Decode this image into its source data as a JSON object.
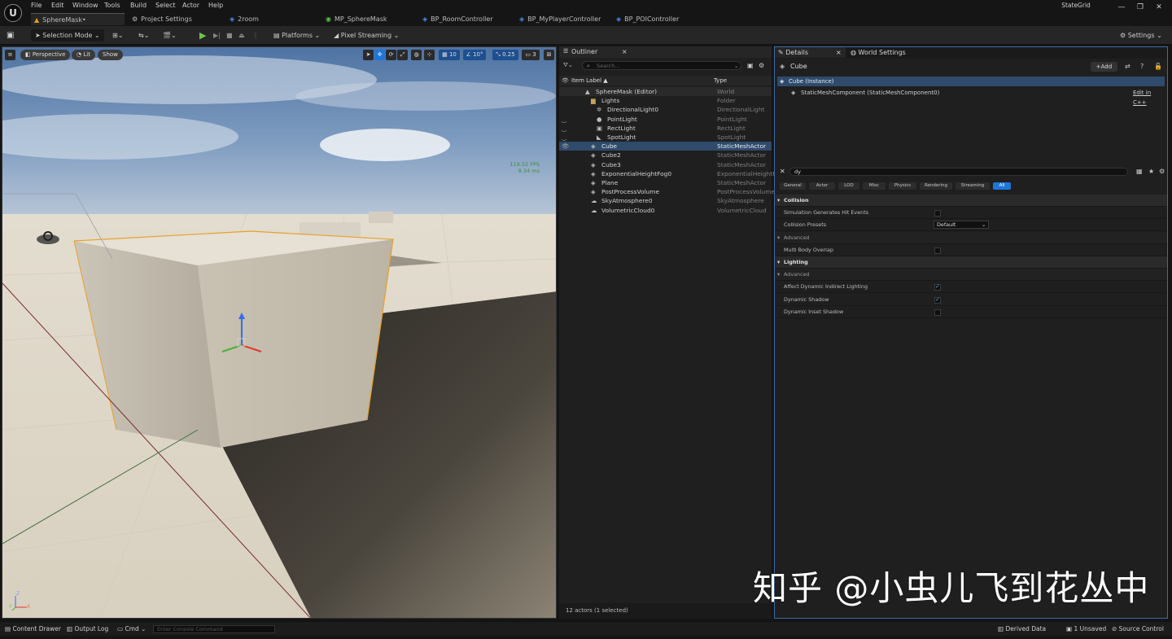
{
  "menu": [
    "File",
    "Edit",
    "Window",
    "Tools",
    "Build",
    "Select",
    "Actor",
    "Help"
  ],
  "tabs": [
    {
      "icon": "level-icon",
      "label": "SphereMask•",
      "active": true
    },
    {
      "icon": "settings-icon",
      "label": "Project Settings",
      "active": false
    },
    {
      "icon": "blueprint-icon",
      "label": "2room",
      "active": false
    },
    {
      "icon": "material-icon",
      "label": "MP_SphereMask",
      "active": false
    },
    {
      "icon": "blueprint-icon",
      "label": "BP_RoomController",
      "active": false
    },
    {
      "icon": "blueprint-icon",
      "label": "BP_MyPlayerController",
      "active": false
    },
    {
      "icon": "blueprint-icon",
      "label": "BP_POIController",
      "active": false
    }
  ],
  "project_name": "StateGrid",
  "toolbar": {
    "selection_mode": "Selection Mode",
    "platforms": "Platforms",
    "pixel_streaming": "Pixel Streaming",
    "settings": "Settings"
  },
  "viewport": {
    "perspective": "Perspective",
    "lit": "Lit",
    "show": "Show",
    "grid_snap": "10",
    "rot_snap": "10°",
    "scale_snap": "0.25",
    "camera_speed": "3",
    "fps": "119.52 FPS",
    "ms": "8.34 ms",
    "axis_z": "Z",
    "axis_y": "Y",
    "axis_x": "X"
  },
  "outliner": {
    "title": "Outliner",
    "search_placeholder": "Search...",
    "col_label": "Item Label",
    "col_type": "Type",
    "rows": [
      {
        "label": "SphereMask (Editor)",
        "type": "World",
        "indent": 2,
        "icon": "▲",
        "eye": false,
        "sel": false,
        "hl": true
      },
      {
        "label": "Lights",
        "type": "Folder",
        "indent": 3,
        "icon": "▆",
        "eye": false,
        "sel": false,
        "hl": false
      },
      {
        "label": "DirectionalLight0",
        "type": "DirectionalLight",
        "indent": 4,
        "icon": "✲",
        "eye": false,
        "sel": false,
        "hl": false
      },
      {
        "label": "PointLight",
        "type": "PointLight",
        "indent": 4,
        "icon": "●",
        "eye": true,
        "sel": false,
        "hl": false
      },
      {
        "label": "RectLight",
        "type": "RectLight",
        "indent": 4,
        "icon": "▣",
        "eye": true,
        "sel": false,
        "hl": false
      },
      {
        "label": "SpotLight",
        "type": "SpotLight",
        "indent": 4,
        "icon": "◣",
        "eye": true,
        "sel": false,
        "hl": false
      },
      {
        "label": "Cube",
        "type": "StaticMeshActor",
        "indent": 3,
        "icon": "◈",
        "eye": true,
        "sel": true,
        "hl": false
      },
      {
        "label": "Cube2",
        "type": "StaticMeshActor",
        "indent": 3,
        "icon": "◈",
        "eye": false,
        "sel": false,
        "hl": false
      },
      {
        "label": "Cube3",
        "type": "StaticMeshActor",
        "indent": 3,
        "icon": "◈",
        "eye": false,
        "sel": false,
        "hl": false
      },
      {
        "label": "ExponentialHeightFog0",
        "type": "ExponentialHeightFi",
        "indent": 3,
        "icon": "◈",
        "eye": false,
        "sel": false,
        "hl": false
      },
      {
        "label": "Plane",
        "type": "StaticMeshActor",
        "indent": 3,
        "icon": "◈",
        "eye": false,
        "sel": false,
        "hl": false
      },
      {
        "label": "PostProcessVolume",
        "type": "PostProcessVolume",
        "indent": 3,
        "icon": "◈",
        "eye": false,
        "sel": false,
        "hl": false
      },
      {
        "label": "SkyAtmosphere0",
        "type": "SkyAtmosphere",
        "indent": 3,
        "icon": "☁",
        "eye": false,
        "sel": false,
        "hl": false
      },
      {
        "label": "VolumetricCloud0",
        "type": "VolumetricCloud",
        "indent": 3,
        "icon": "☁",
        "eye": false,
        "sel": false,
        "hl": false
      }
    ],
    "footer": "12 actors (1 selected)"
  },
  "details": {
    "title": "Details",
    "world_settings": "World Settings",
    "actor_name": "Cube",
    "add": "+Add",
    "instance": "Cube (Instance)",
    "component": "StaticMeshComponent (StaticMeshComponent0)",
    "edit_cpp": "Edit in C++",
    "search_value": "dy",
    "filter_tabs": [
      "General",
      "Actor",
      "LOD",
      "Misc",
      "Physics",
      "Rendering",
      "Streaming",
      "All"
    ],
    "active_filter": "All",
    "props": [
      {
        "kind": "cat",
        "label": "Collision"
      },
      {
        "kind": "prop",
        "label": "Simulation Generates Hit Events",
        "check": false
      },
      {
        "kind": "select",
        "label": "Collision Presets",
        "value": "Default"
      },
      {
        "kind": "adv",
        "label": "Advanced"
      },
      {
        "kind": "prop",
        "label": "Multi Body Overlap",
        "check": false
      },
      {
        "kind": "cat",
        "label": "Lighting"
      },
      {
        "kind": "adv",
        "label": "Advanced"
      },
      {
        "kind": "prop",
        "label": "Affect Dynamic Indirect Lighting",
        "check": true
      },
      {
        "kind": "prop",
        "label": "Dynamic Shadow",
        "check": true
      },
      {
        "kind": "prop",
        "label": "Dynamic Inset Shadow",
        "check": false
      }
    ]
  },
  "statusbar": {
    "content_drawer": "Content Drawer",
    "output_log": "Output Log",
    "cmd": "Cmd",
    "console_placeholder": "Enter Console Command",
    "derived_data": "Derived Data",
    "unsaved": "1 Unsaved",
    "source_control": "Source Control"
  },
  "watermark": "知乎 @小虫儿飞到花丛中"
}
